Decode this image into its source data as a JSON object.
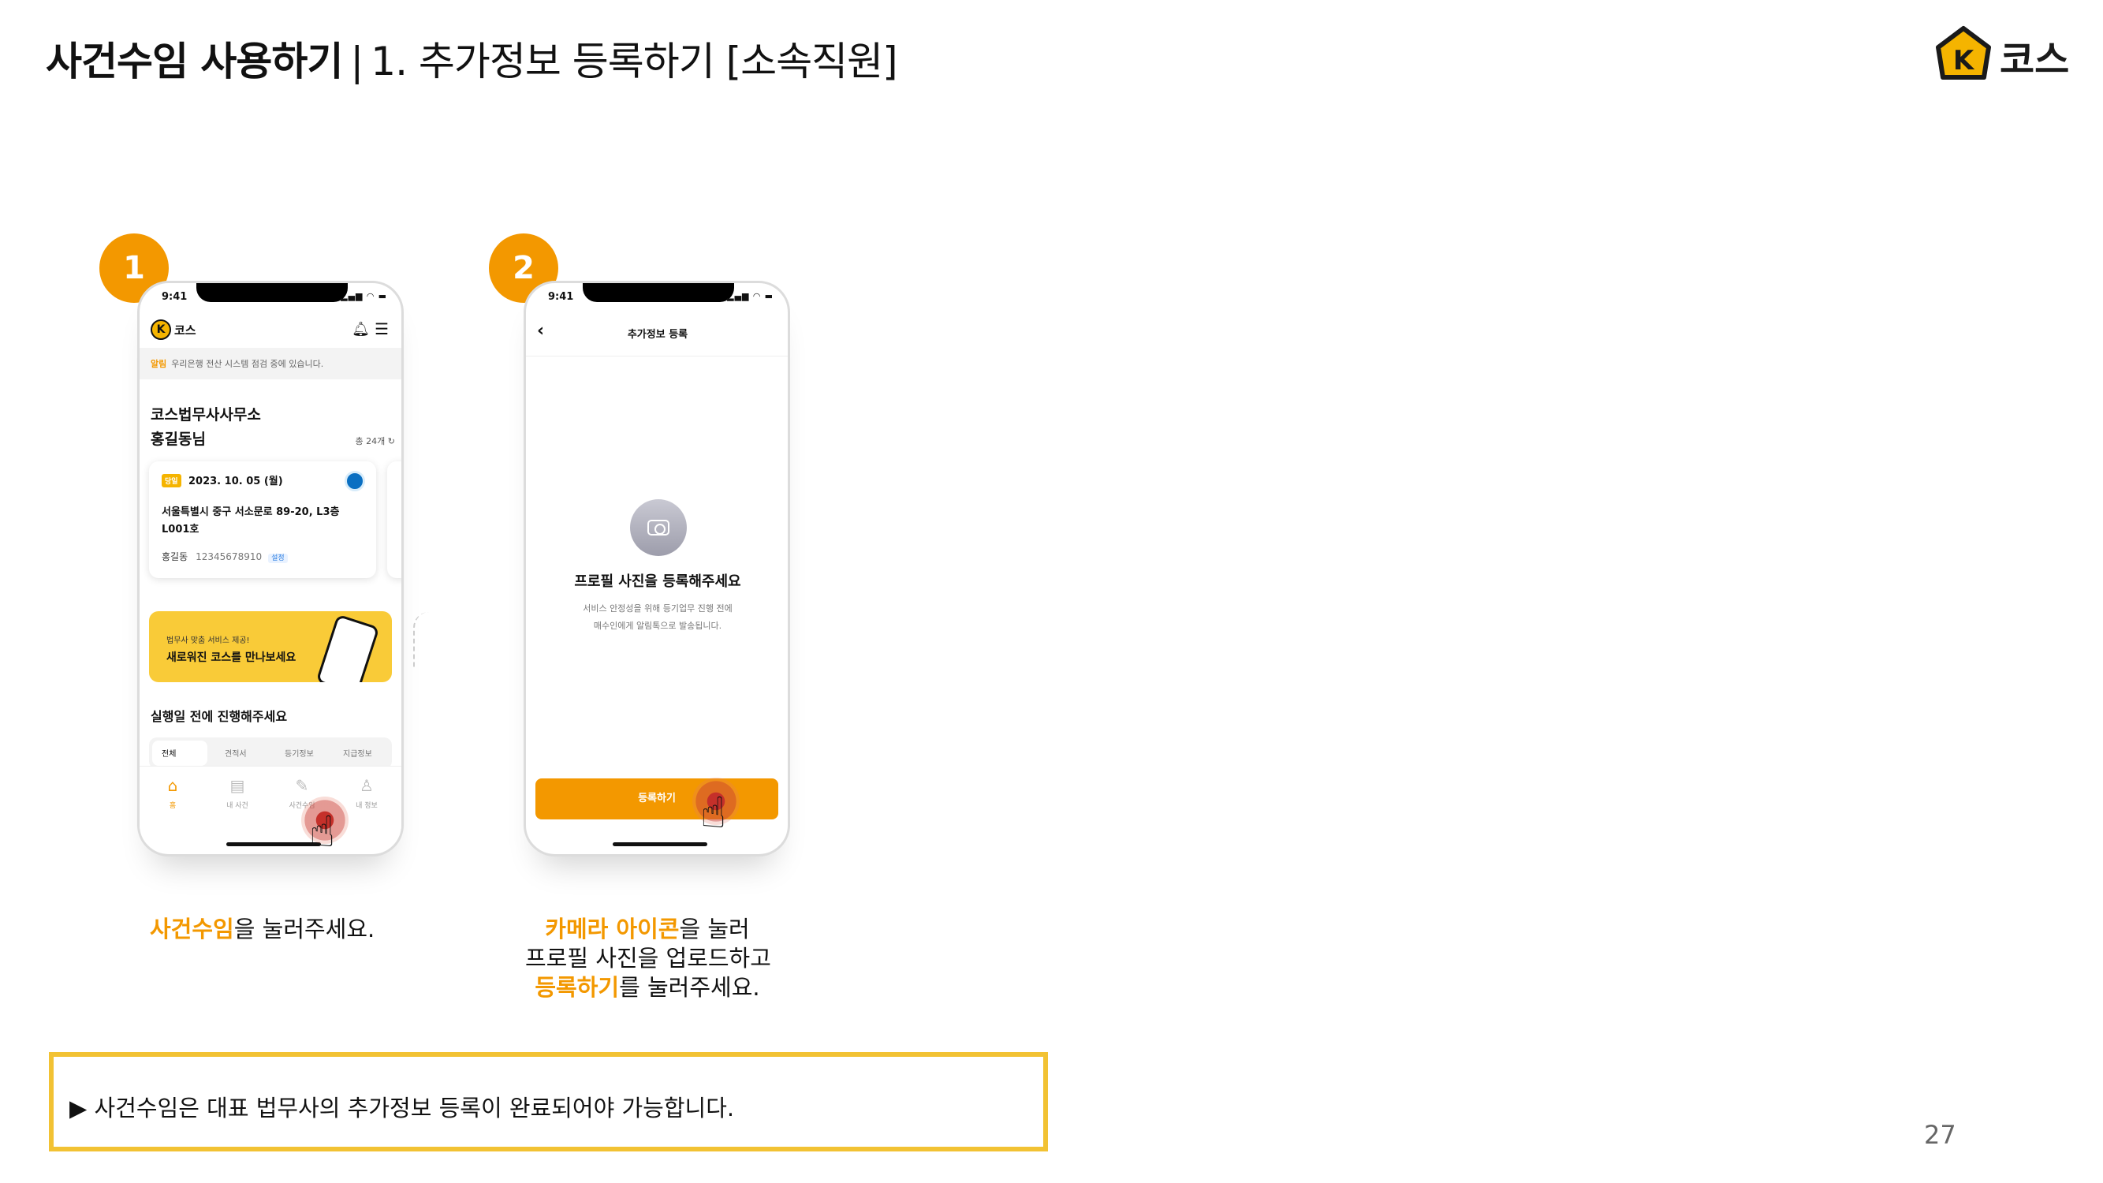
{
  "header": {
    "title_bold": "사건수임 사용하기",
    "separator": "|",
    "title_sub": "1. 추가정보 등록하기 [소속직원]"
  },
  "brand": {
    "logo_text": "코스",
    "logo_mark": "K",
    "accent": "#F39800",
    "border_accent": "#F2C233"
  },
  "steps": [
    {
      "number": "1"
    },
    {
      "number": "2"
    }
  ],
  "phone1": {
    "time": "9:41",
    "app_name": "코스",
    "notice_tag": "알림",
    "notice_text": "우리은행 전산 시스템 점검 중에 있습니다.",
    "office_name": "코스법무사사무소",
    "user_greeting": "홍길동님",
    "total_count": "총 24개 ↻",
    "card": {
      "day_tag": "당일",
      "date": "2023. 10. 05 (월)",
      "address": "서울특별시 중구 서소문로 89-20, L3층 L001호",
      "owner": "홍길동",
      "number": "12345678910",
      "setting": "설정"
    },
    "banner_small": "법무사 맞춤 서비스 제공!",
    "banner_big": "새로워진 코스를 만나보세요",
    "section_title": "실행일 전에 진행해주세요",
    "tabs": [
      "전체",
      "견적서",
      "등기정보",
      "지급정보"
    ],
    "nav": [
      {
        "label": "홈",
        "icon": "home-icon"
      },
      {
        "label": "내 사건",
        "icon": "document-icon"
      },
      {
        "label": "사건수임",
        "icon": "pencil-icon"
      },
      {
        "label": "내 정보",
        "icon": "user-icon"
      }
    ]
  },
  "phone2": {
    "time": "9:41",
    "screen_title": "추가정보 등록",
    "heading": "프로필 사진을 등록해주세요",
    "desc_line1": "서비스 안정성을 위해 등기업무 진행 전에",
    "desc_line2": "매수인에게 알림톡으로 발송됩니다.",
    "button_label": "등록하기"
  },
  "captions": {
    "step1_hl": "사건수임",
    "step1_rest": "을 눌러주세요.",
    "step2_hl1": "카메라 아이콘",
    "step2_rest1": "을 눌러",
    "step2_line2": "프로필 사진을 업로드하고",
    "step2_hl2": "등록하기",
    "step2_rest3": "를 눌러주세요."
  },
  "note": "▶ 사건수임은 대표 법무사의 추가정보 등록이 완료되어야 가능합니다.",
  "page_number": "27"
}
